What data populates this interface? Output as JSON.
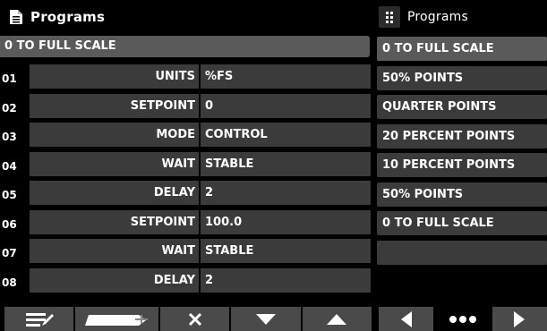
{
  "header": {
    "title": "Programs"
  },
  "selected_program": "0 TO FULL SCALE",
  "steps": [
    {
      "index": "01",
      "param": "UNITS",
      "value": "%FS"
    },
    {
      "index": "02",
      "param": "SETPOINT",
      "value": "0"
    },
    {
      "index": "03",
      "param": "MODE",
      "value": "CONTROL"
    },
    {
      "index": "04",
      "param": "WAIT",
      "value": "STABLE"
    },
    {
      "index": "05",
      "param": "DELAY",
      "value": "2"
    },
    {
      "index": "06",
      "param": "SETPOINT",
      "value": "100.0"
    },
    {
      "index": "07",
      "param": "WAIT",
      "value": "STABLE"
    },
    {
      "index": "08",
      "param": "DELAY",
      "value": "2"
    }
  ],
  "program_list": {
    "title": "Programs",
    "items": [
      "0 TO FULL SCALE",
      "50% POINTS",
      "QUARTER POINTS",
      "20 PERCENT POINTS",
      "10 PERCENT POINTS",
      "50% POINTS",
      "0 TO FULL SCALE",
      ""
    ],
    "active_index": 0
  },
  "toolbar_left": [
    "edit-list-icon",
    "add-step-icon",
    "delete-icon",
    "move-down-icon",
    "move-up-icon"
  ],
  "toolbar_right": [
    "prev-icon",
    "more-icon",
    "next-icon"
  ],
  "colors": {
    "background": "#000000",
    "cell": "#3b3b3b",
    "selected": "#5a5a5a",
    "button": "#4a4a4a",
    "text": "#ffffff"
  }
}
